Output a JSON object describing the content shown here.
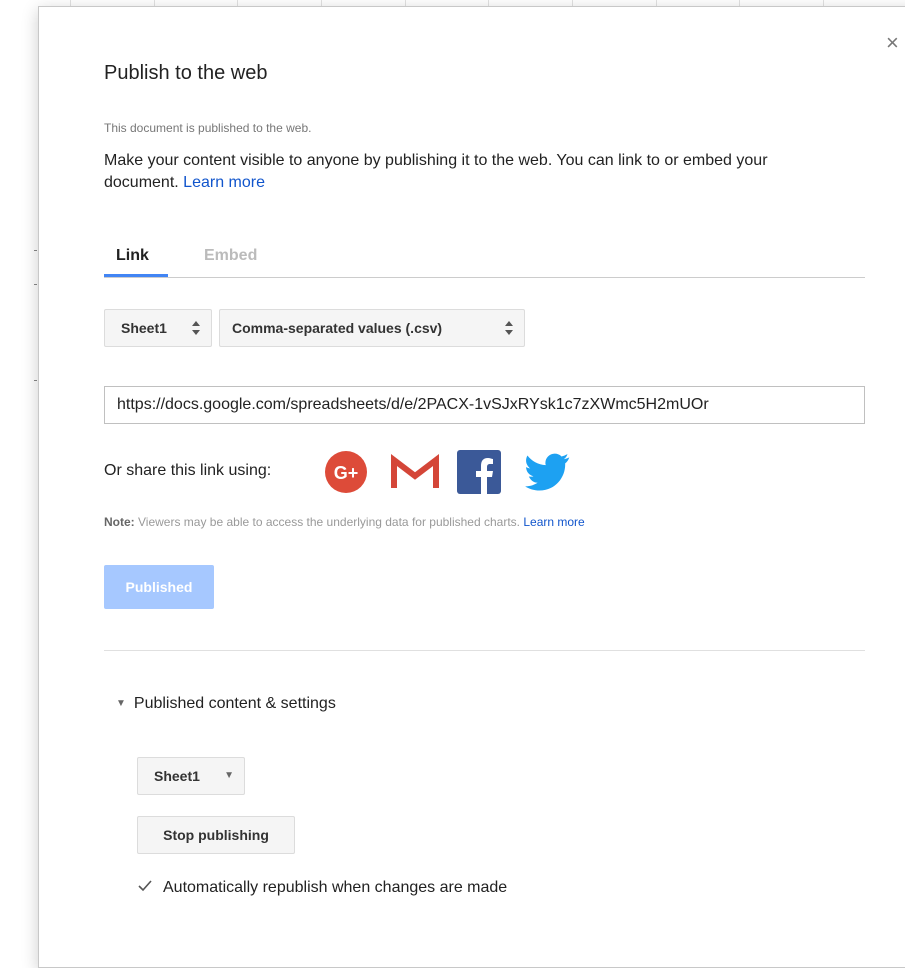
{
  "dialog": {
    "title": "Publish to the web",
    "status": "This document is published to the web.",
    "description": "Make your content visible to anyone by publishing it to the web. You can link to or embed your document.",
    "learn_more": "Learn more",
    "close_glyph": "×"
  },
  "tabs": [
    {
      "label": "Link",
      "active": true
    },
    {
      "label": "Embed",
      "active": false
    }
  ],
  "selects": {
    "sheet": "Sheet1",
    "format": "Comma-separated values (.csv)"
  },
  "url": "https://docs.google.com/spreadsheets/d/e/2PACX-1vSJxRYsk1c7zXWmc5H2mUOr",
  "share": {
    "label": "Or share this link using:",
    "services": [
      "google-plus",
      "gmail",
      "facebook",
      "twitter"
    ]
  },
  "note": {
    "prefix": "Note:",
    "text": " Viewers may be able to access the underlying data for published charts.",
    "learn_more": "Learn more"
  },
  "publish_button": "Published",
  "settings": {
    "expander_label": "Published content & settings",
    "sheet_dropdown": "Sheet1",
    "stop_button": "Stop publishing",
    "auto_republish_label": "Automatically republish when changes are made",
    "auto_republish_checked": true
  },
  "colors": {
    "accent": "#4285f4",
    "link": "#1155cc",
    "published_button": "#a6c8ff",
    "gplus": "#dd4b39",
    "gmail": "#d44638",
    "facebook": "#3b5998",
    "twitter": "#1da1f2"
  }
}
